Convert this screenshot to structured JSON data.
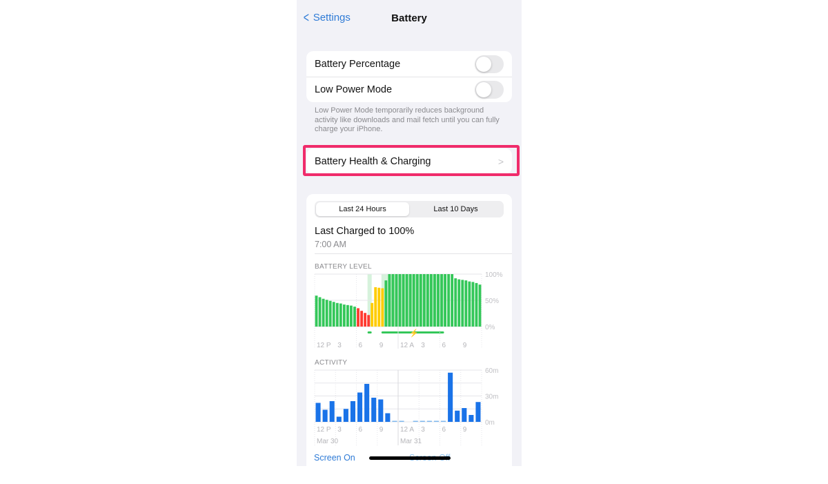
{
  "nav": {
    "back_label": "Settings",
    "title": "Battery"
  },
  "settings": {
    "battery_percentage": {
      "label": "Battery Percentage",
      "on": false
    },
    "low_power_mode": {
      "label": "Low Power Mode",
      "on": false
    },
    "footnote": "Low Power Mode temporarily reduces background activity like downloads and mail fetch until you can fully charge your iPhone."
  },
  "battery_health": {
    "label": "Battery Health & Charging",
    "highlight_color": "#f02c6b"
  },
  "usage": {
    "tabs": [
      {
        "label": "Last 24 Hours",
        "selected": true
      },
      {
        "label": "Last 10 Days",
        "selected": false
      }
    ],
    "last_charged": "Last Charged to 100%",
    "last_charged_time": "7:00 AM",
    "battery_level": {
      "title": "BATTERY LEVEL",
      "y_ticks": [
        "100%",
        "50%",
        "0%"
      ],
      "x_ticks": [
        {
          "hour": 0,
          "label": "12 P"
        },
        {
          "hour": 3,
          "label": "3"
        },
        {
          "hour": 6,
          "label": "6"
        },
        {
          "hour": 9,
          "label": "9"
        },
        {
          "hour": 12,
          "label": "12 A"
        },
        {
          "hour": 15,
          "label": "3"
        },
        {
          "hour": 18,
          "label": "6"
        },
        {
          "hour": 21,
          "label": "9"
        }
      ],
      "values_half_hourly": [
        59,
        56,
        53,
        51,
        49,
        47,
        45,
        44,
        42,
        41,
        40,
        38,
        35,
        30,
        26,
        22,
        45,
        75,
        74,
        73,
        88,
        100,
        100,
        100,
        100,
        100,
        100,
        100,
        100,
        100,
        100,
        100,
        100,
        100,
        100,
        100,
        100,
        100,
        100,
        100,
        92,
        90,
        89,
        88,
        86,
        85,
        83,
        80
      ],
      "states": [
        "g",
        "g",
        "g",
        "g",
        "g",
        "g",
        "g",
        "g",
        "g",
        "g",
        "g",
        "g",
        "r",
        "r",
        "r",
        "r",
        "y",
        "y",
        "y",
        "y",
        "g",
        "g",
        "g",
        "g",
        "g",
        "g",
        "g",
        "g",
        "g",
        "g",
        "g",
        "g",
        "g",
        "g",
        "g",
        "g",
        "g",
        "g",
        "g",
        "g",
        "g",
        "g",
        "g",
        "g",
        "g",
        "g",
        "g",
        "g"
      ],
      "charging_periods_hours": [
        [
          7.6,
          8.2
        ],
        [
          9.6,
          18.6
        ]
      ],
      "colors": {
        "normal": "#34c759",
        "low": "#ff3b30",
        "low_power": "#ffcc00",
        "charging_band": "#d6f2dc"
      }
    },
    "activity": {
      "title": "ACTIVITY",
      "y_ticks": [
        "60m",
        "30m",
        "0m"
      ],
      "x_ticks": [
        {
          "hour": 0,
          "label": "12 P"
        },
        {
          "hour": 3,
          "label": "3"
        },
        {
          "hour": 6,
          "label": "6"
        },
        {
          "hour": 9,
          "label": "9"
        },
        {
          "hour": 12,
          "label": "12 A"
        },
        {
          "hour": 15,
          "label": "3"
        },
        {
          "hour": 18,
          "label": "6"
        },
        {
          "hour": 21,
          "label": "9"
        }
      ],
      "dates": [
        {
          "hour": 0,
          "label": "Mar 30"
        },
        {
          "hour": 12,
          "label": "Mar 31"
        }
      ],
      "screen_on_minutes": [
        22,
        14,
        24,
        6,
        15,
        24,
        34,
        44,
        28,
        26,
        10,
        0,
        0,
        0,
        0,
        0,
        0,
        0,
        0,
        57,
        13,
        16,
        8,
        23
      ],
      "screen_off_minutes": [
        0,
        0,
        0,
        0,
        0,
        0,
        0,
        0,
        0,
        0,
        0,
        1,
        0.5,
        0,
        0.5,
        0.5,
        0.5,
        0.5,
        0.5,
        0,
        0,
        0,
        0,
        0
      ],
      "colors": {
        "screen_on": "#1a73e8",
        "screen_off": "#7fb8ee"
      }
    },
    "legend": {
      "screen_on": "Screen On",
      "screen_off": "Screen Off"
    }
  }
}
